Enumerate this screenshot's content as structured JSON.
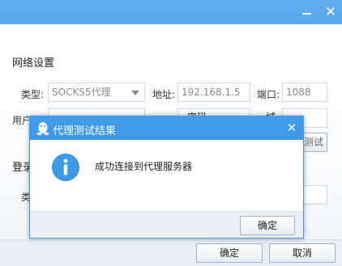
{
  "window": {
    "minimize_symbol": "",
    "close_symbol": "✕"
  },
  "settings": {
    "network_section": "网络设置",
    "type_label": "类型:",
    "type_value": "SOCKS5代理",
    "address_label": "地址:",
    "address_value": "192.168.1.5",
    "port_label": "端口:",
    "port_value": "1088",
    "username_label": "用户名",
    "password_label_partial": "密码",
    "domain_label_partial": "域",
    "test_button_partial": "测试",
    "login_section_partial": "登录",
    "login_type_partial": "类"
  },
  "footer": {
    "ok_label": "确定",
    "cancel_label": "取消"
  },
  "dialog": {
    "title": "代理测试结果",
    "close_symbol": "✕",
    "message": "成功连接到代理服务器",
    "ok_label": "确定"
  },
  "colors": {
    "titlebar": "#5aa6eb",
    "dialog_titlebar": "#3d9bea",
    "info_icon": "#2f8fe0"
  }
}
